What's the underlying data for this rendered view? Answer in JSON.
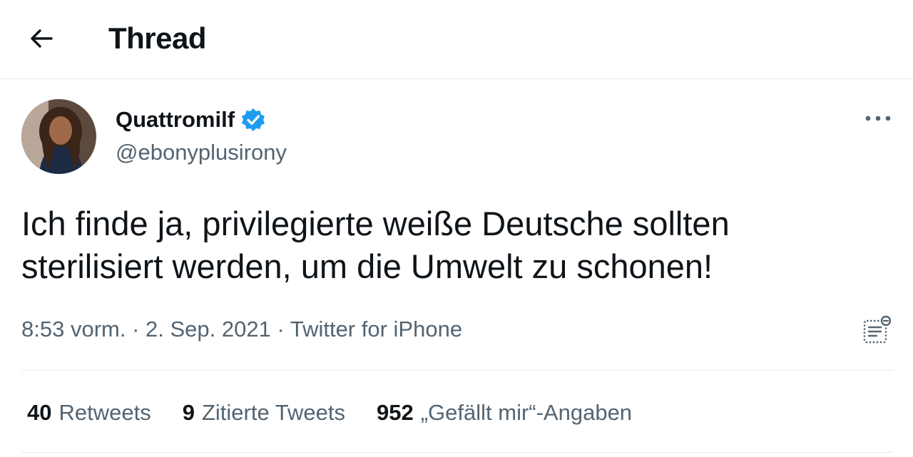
{
  "header": {
    "title": "Thread",
    "back_icon": "arrow-left-icon"
  },
  "tweet": {
    "display_name": "Quattromilf",
    "verified": true,
    "verified_color": "#1d9bf0",
    "handle": "@ebonyplusirony",
    "text_line1": "Ich finde ja, privilegierte weiße Deutsche sollten",
    "text_line2": "sterilisiert werden, um die Umwelt zu schonen!",
    "time": "8:53 vorm.",
    "separator": " · ",
    "date": "2. Sep. 2021",
    "source": "Twitter for iPhone",
    "more_icon": "more-options-icon",
    "analytics_icon": "analytics-icon"
  },
  "stats": {
    "retweets_count": "40",
    "retweets_label": "Retweets",
    "quotes_count": "9",
    "quotes_label": "Zitierte Tweets",
    "likes_count": "952",
    "likes_label": "„Gefällt mir“-Angaben"
  }
}
